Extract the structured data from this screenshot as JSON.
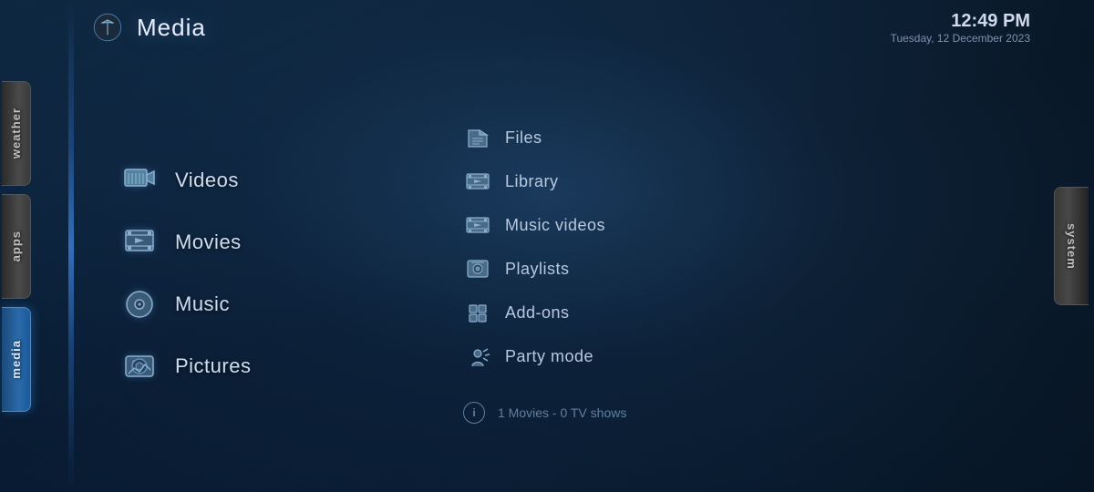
{
  "header": {
    "title": "Media",
    "time": "12:49 PM",
    "date": "Tuesday, 12 December 2023"
  },
  "left_tabs": [
    {
      "id": "weather",
      "label": "weather",
      "active": false
    },
    {
      "id": "apps",
      "label": "apps",
      "active": false
    },
    {
      "id": "media",
      "label": "media",
      "active": true
    }
  ],
  "right_tab": {
    "label": "system"
  },
  "main_menu": [
    {
      "id": "videos",
      "label": "Videos",
      "icon": "🎬"
    },
    {
      "id": "movies",
      "label": "Movies",
      "icon": "🎞️"
    },
    {
      "id": "music",
      "label": "Music",
      "icon": "🎵"
    },
    {
      "id": "pictures",
      "label": "Pictures",
      "icon": "📷"
    }
  ],
  "sub_menu": [
    {
      "id": "files",
      "label": "Files",
      "icon": "📁"
    },
    {
      "id": "library",
      "label": "Library",
      "icon": "🎞️"
    },
    {
      "id": "music-videos",
      "label": "Music videos",
      "icon": "🎞️"
    },
    {
      "id": "playlists",
      "label": "Playlists",
      "icon": "🎛️"
    },
    {
      "id": "add-ons",
      "label": "Add-ons",
      "icon": "🧩"
    },
    {
      "id": "party-mode",
      "label": "Party mode",
      "icon": "🎊"
    }
  ],
  "info": {
    "text": "1 Movies  -  0 TV shows"
  }
}
